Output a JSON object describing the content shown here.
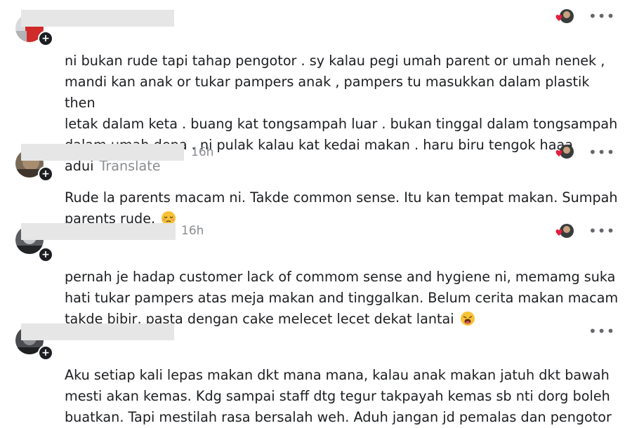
{
  "comments": [
    {
      "timestamp": "",
      "text": "ni bukan rude tapi tahap pengotor . sy kalau pegi umah parent or umah nenek ,\nmandi kan anak or tukar pampers anak , pampers tu masukkan dalam plastik then\nletak dalam keta . buang kat tongsampah luar . bukan tinggal dalam tongsampah\ndalam umah depa . ni pulak kalau kat kedai makan . haru biru tengok haaa\nadui",
      "translate_label": "Translate",
      "emoji": null
    },
    {
      "timestamp": "16h",
      "text": "Rude la parents macam ni. Takde common sense. Itu kan tempat makan. Sumpah\nparents rude.",
      "translate_label": "",
      "emoji": "pensive-face-emoji"
    },
    {
      "timestamp": "16h",
      "text": "pernah je hadap customer lack of commom sense and hygiene ni, memamg suka\nhati tukar pampers atas meja makan and tinggalkan. Belum cerita makan macam\ntakde bibir, pasta dengan cake melecet lecet dekat lantai",
      "translate_label": "",
      "emoji": "weary-face-emoji"
    },
    {
      "timestamp": "",
      "text": "Aku setiap kali lepas makan dkt mana mana, kalau anak makan jatuh dkt bawah\nmesti akan kemas. Kdg sampai staff dtg tegur takpayah kemas sb nti dorg boleh\nbuatkan. Tapi mestilah rasa bersalah weh. Aduh jangan jd pemalas dan pengotor",
      "translate_label": "",
      "emoji": null
    }
  ],
  "icons": {
    "avatar_badge": "plus-circle-icon",
    "reaction": "heart-reaction-icon",
    "more": "more-options-icon"
  },
  "more_glyph": "•••",
  "badge_glyph": "+",
  "colors": {
    "text": "#1c1e21",
    "muted": "#8a8d91",
    "heart": "#e41e3f",
    "redacted": "#e6e6e6"
  }
}
